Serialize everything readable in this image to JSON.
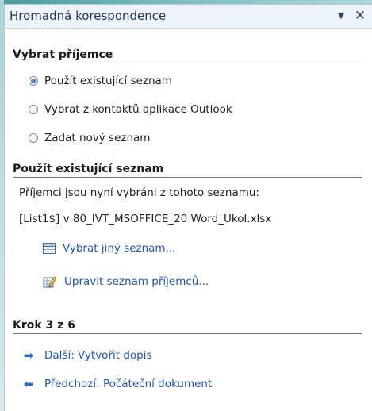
{
  "panel": {
    "title": "Hromadná korespondence",
    "menu_glyph": "▼",
    "close_glyph": "✕"
  },
  "select_recipients": {
    "heading": "Vybrat příjemce",
    "options": [
      {
        "label": "Použít existující seznam",
        "selected": true
      },
      {
        "label": "Vybrat z kontaktů aplikace Outlook",
        "selected": false
      },
      {
        "label": "Zadat nový seznam",
        "selected": false
      }
    ]
  },
  "use_existing": {
    "heading": "Použít existující seznam",
    "description": "Příjemci jsou nyní vybráni z tohoto seznamu:",
    "source": "[List1$] v 80_IVT_MSOFFICE_20 Word_Ukol.xlsx",
    "choose_other_link": "Vybrat jiný seznam...",
    "edit_list_link": "Upravit seznam příjemců...",
    "choose_other_icon": "table-icon",
    "edit_list_icon": "edit-list-icon"
  },
  "step": {
    "heading": "Krok 3 z 6",
    "next_link": "Další: Vytvořit dopis",
    "prev_link": "Předchozí: Počáteční dokument",
    "next_icon": "arrow-right-icon",
    "prev_icon": "arrow-left-icon"
  },
  "colors": {
    "link": "#1f55b5",
    "arrow": "#2e6bc4",
    "header_bg": "#eef3fa"
  }
}
